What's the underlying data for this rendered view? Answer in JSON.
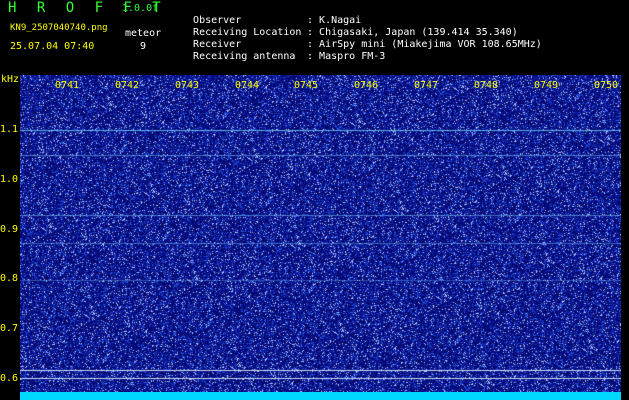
{
  "header": {
    "title": "H R O F F T",
    "version": "1.0.0f",
    "filename": "KN9_2507040740.png",
    "meteor_label": "meteor",
    "timestamp": "25.07.04 07:40",
    "meteor_count": "9"
  },
  "info": [
    {
      "key": "Observer",
      "value": "K.Nagai"
    },
    {
      "key": "Receiving Location",
      "value": "Chigasaki, Japan (139.414 35.340)"
    },
    {
      "key": "Receiver",
      "value": "AirSpy mini (Miakejima VOR 108.65MHz)"
    },
    {
      "key": "Receiving antenna",
      "value": "Maspro FM-3"
    }
  ],
  "plot": {
    "y_unit": "kHz",
    "y_labels": [
      "1.1",
      "1.0",
      "0.9",
      "0.8",
      "0.7",
      "0.6"
    ],
    "time_labels": [
      "0741",
      "0742",
      "0743",
      "0744",
      "0745",
      "0746",
      "0747",
      "0748",
      "0749",
      "0750"
    ],
    "background_color": "#0a0a9a",
    "axis_color": "#ffff00",
    "bottom_bar_color": "#00d8ff"
  }
}
